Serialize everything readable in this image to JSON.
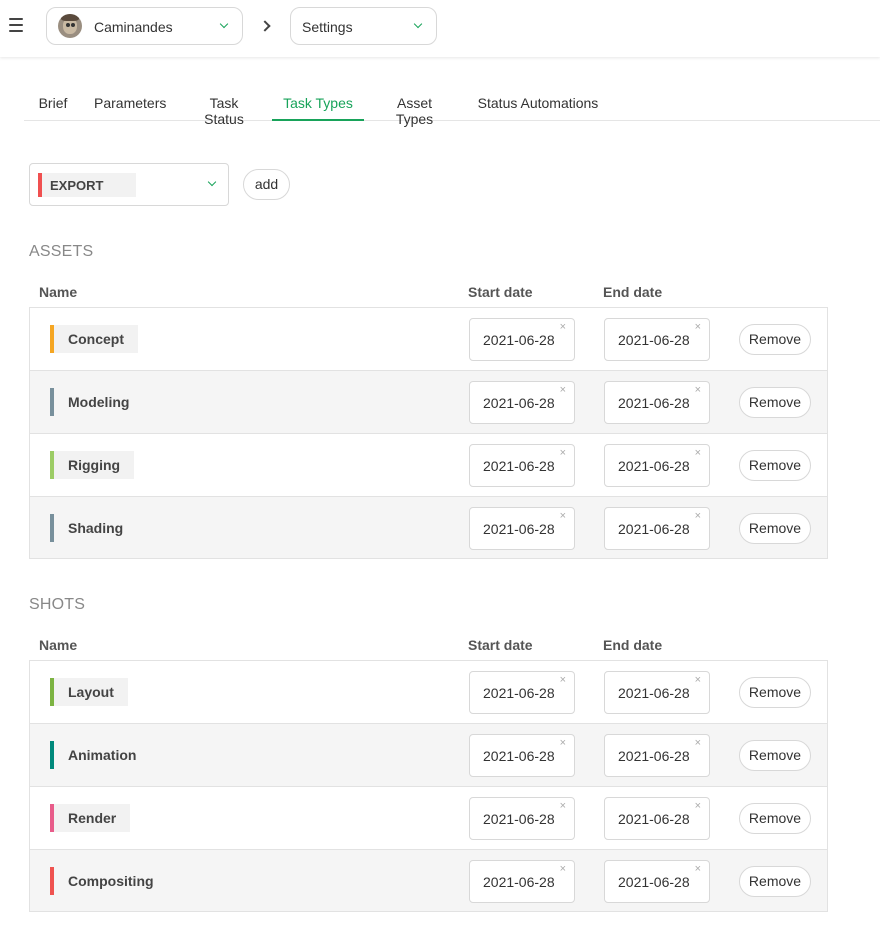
{
  "header": {
    "production": "Caminandes",
    "section": "Settings"
  },
  "tabs": [
    {
      "label": "Brief"
    },
    {
      "label": "Parameters"
    },
    {
      "label": "Task Status"
    },
    {
      "label": "Task Types"
    },
    {
      "label": "Asset Types"
    },
    {
      "label": "Status Automations"
    }
  ],
  "active_tab": "Task Types",
  "task_type_select": {
    "value": "EXPORT",
    "color": "#f05050"
  },
  "add_button": "add",
  "columns": {
    "name": "Name",
    "start": "Start date",
    "end": "End date"
  },
  "remove_label": "Remove",
  "clear_icon": "×",
  "assets": {
    "title": "ASSETS",
    "rows": [
      {
        "name": "Concept",
        "color": "#f5a623",
        "start": "2021-06-28",
        "end": "2021-06-28"
      },
      {
        "name": "Modeling",
        "color": "#78909c",
        "start": "2021-06-28",
        "end": "2021-06-28"
      },
      {
        "name": "Rigging",
        "color": "#9ccc65",
        "start": "2021-06-28",
        "end": "2021-06-28"
      },
      {
        "name": "Shading",
        "color": "#78909c",
        "start": "2021-06-28",
        "end": "2021-06-28"
      }
    ]
  },
  "shots": {
    "title": "SHOTS",
    "rows": [
      {
        "name": "Layout",
        "color": "#7cb342",
        "start": "2021-06-28",
        "end": "2021-06-28"
      },
      {
        "name": "Animation",
        "color": "#00897b",
        "start": "2021-06-28",
        "end": "2021-06-28"
      },
      {
        "name": "Render",
        "color": "#e85c8a",
        "start": "2021-06-28",
        "end": "2021-06-28"
      },
      {
        "name": "Compositing",
        "color": "#ef5350",
        "start": "2021-06-28",
        "end": "2021-06-28"
      }
    ]
  }
}
